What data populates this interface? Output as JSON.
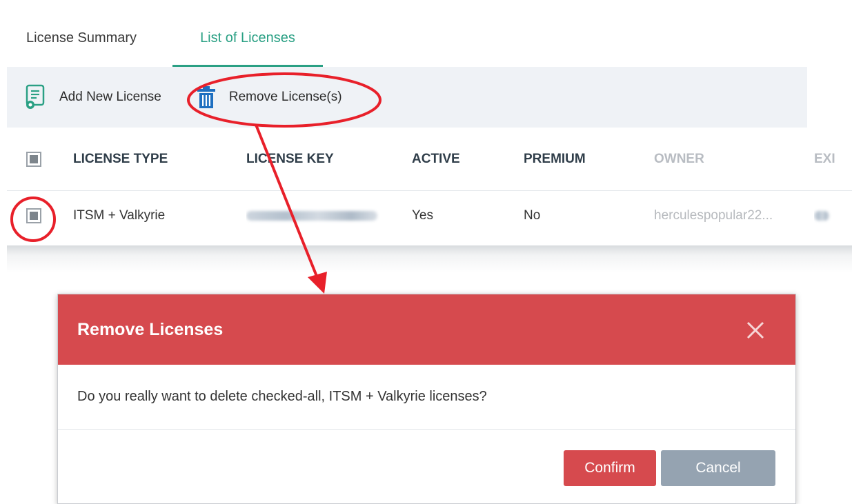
{
  "tabs": [
    {
      "label": "License Summary"
    },
    {
      "label": "List of Licenses",
      "active": true
    }
  ],
  "toolbar": {
    "add_label": "Add New License",
    "remove_label": "Remove License(s)"
  },
  "table": {
    "headers": {
      "type": "LICENSE TYPE",
      "key": "LICENSE KEY",
      "active": "ACTIVE",
      "premium": "PREMIUM",
      "owner": "OWNER",
      "expiry": "EXI"
    },
    "rows": [
      {
        "type": "ITSM + Valkyrie",
        "active": "Yes",
        "premium": "No",
        "owner": "herculespopular22..."
      }
    ]
  },
  "modal": {
    "title": "Remove Licenses",
    "message": "Do you really want to delete checked-all, ITSM + Valkyrie licenses?",
    "confirm_label": "Confirm",
    "cancel_label": "Cancel"
  },
  "colors": {
    "accent_tab": "#2aa084",
    "modal_header": "#d64a4e",
    "confirm_button": "#d64a4e",
    "cancel_button": "#95a3b1",
    "annotation": "#e8202a"
  }
}
